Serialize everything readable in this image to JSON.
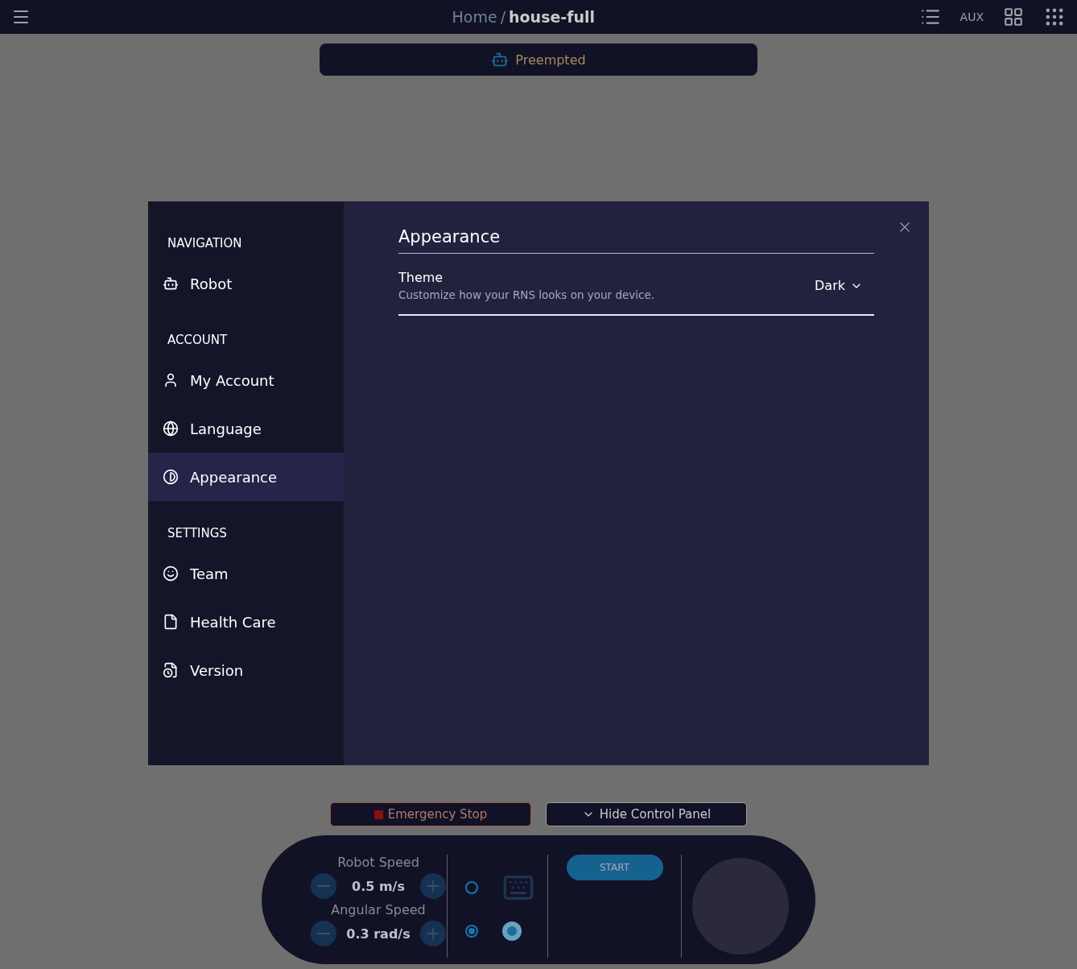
{
  "top_bar": {
    "breadcrumb": {
      "home": "Home",
      "separator": "/",
      "current": "house-full"
    },
    "aux": "AUX"
  },
  "status_pill": {
    "label": "Preempted"
  },
  "settings": {
    "sections": [
      {
        "heading": "NAVIGATION",
        "items": [
          {
            "label": "Robot",
            "selected": false
          }
        ]
      },
      {
        "heading": "ACCOUNT",
        "items": [
          {
            "label": "My Account",
            "selected": false
          },
          {
            "label": "Language",
            "selected": false
          },
          {
            "label": "Appearance",
            "selected": true
          }
        ]
      },
      {
        "heading": "SETTINGS",
        "items": [
          {
            "label": "Team",
            "selected": false
          },
          {
            "label": "Health Care",
            "selected": false
          },
          {
            "label": "Version",
            "selected": false
          }
        ]
      }
    ],
    "panel": {
      "title": "Appearance",
      "rows": [
        {
          "label": "Theme",
          "description": "Customize how your RNS looks on your device.",
          "value": "Dark"
        }
      ]
    }
  },
  "controls": {
    "emergency_stop": "Emergency Stop",
    "hide_panel": "Hide Control Panel",
    "speeds": [
      {
        "label": "Robot Speed",
        "value": "0.5 m/s"
      },
      {
        "label": "Angular Speed",
        "value": "0.3 rad/s"
      }
    ],
    "modes": [
      {
        "kind": "keyboard",
        "selected": false
      },
      {
        "kind": "joystick",
        "selected": true
      }
    ],
    "start": "START"
  }
}
